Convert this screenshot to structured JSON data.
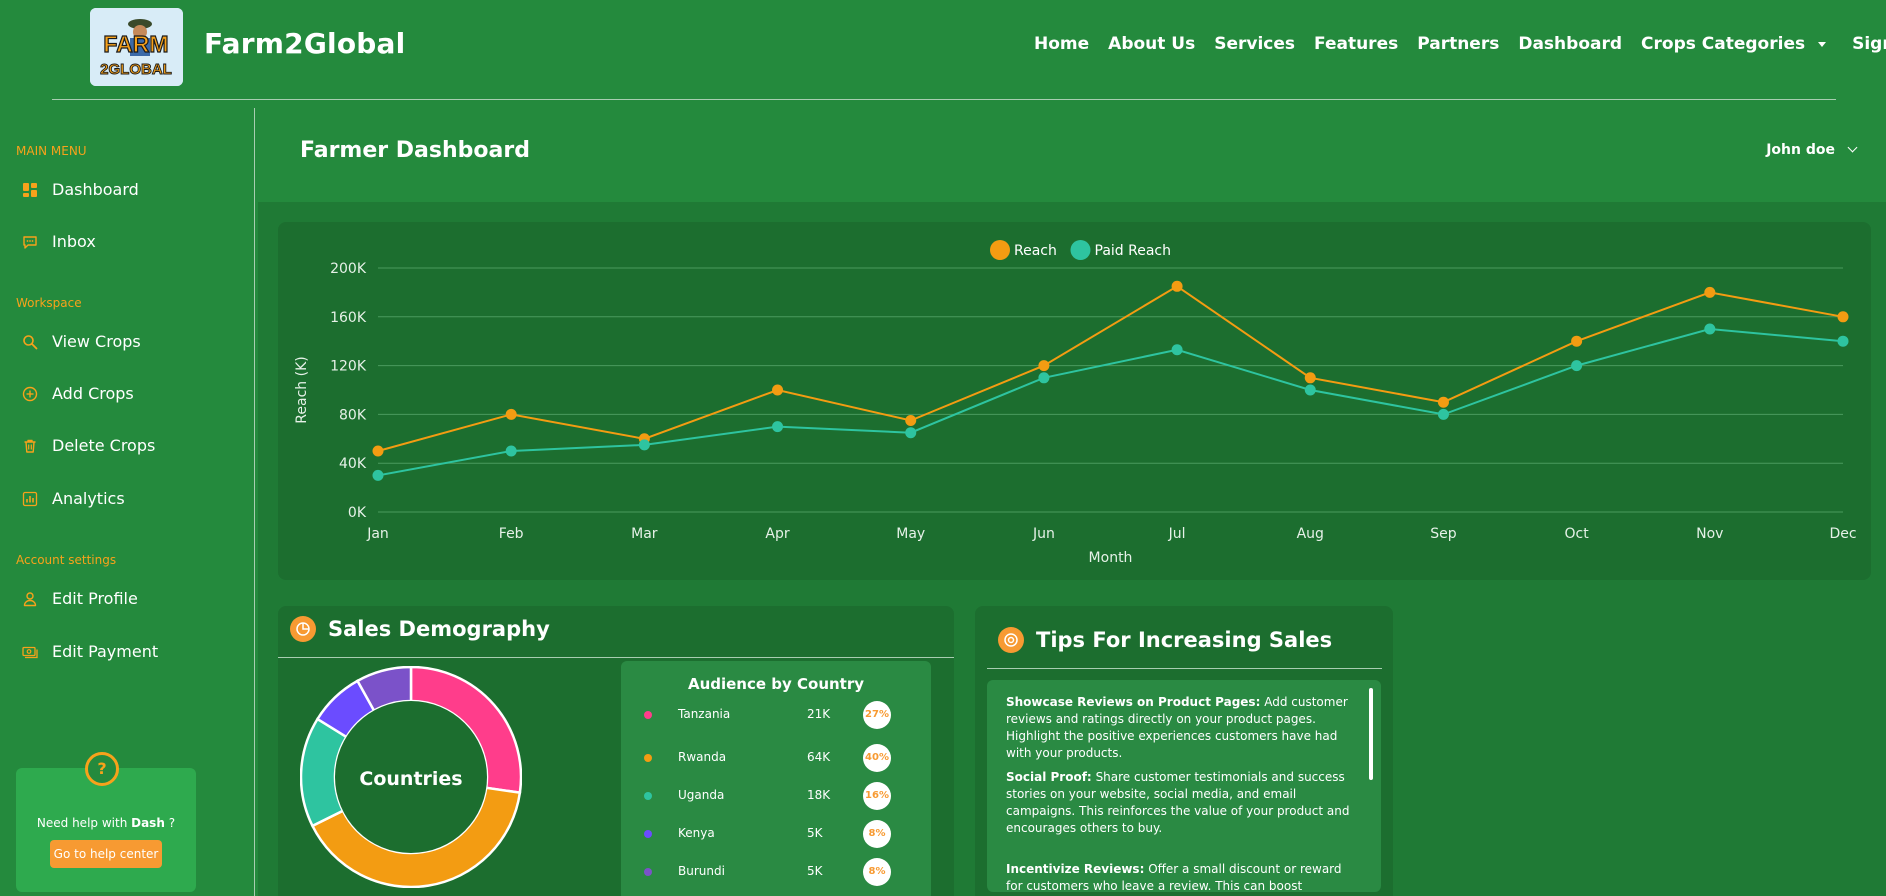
{
  "brand": {
    "name": "Farm2Global",
    "logo_text_top": "FARM",
    "logo_text_bottom": "2GLOBAL"
  },
  "nav": {
    "items": [
      "Home",
      "About Us",
      "Services",
      "Features",
      "Partners",
      "Dashboard"
    ],
    "dropdown_label": "Crops Categories",
    "signup": "Sign up"
  },
  "sidebar": {
    "main_menu_heading": "MAIN MENU",
    "main_items": [
      {
        "label": "Dashboard",
        "icon": "grid-icon"
      },
      {
        "label": "Inbox",
        "icon": "chat-icon"
      }
    ],
    "workspace_heading": "Workspace",
    "workspace_items": [
      {
        "label": "View Crops",
        "icon": "search-icon"
      },
      {
        "label": "Add Crops",
        "icon": "plus-circle-icon"
      },
      {
        "label": "Delete Crops",
        "icon": "trash-icon"
      },
      {
        "label": "Analytics",
        "icon": "chart-icon"
      }
    ],
    "account_heading": "Account settings",
    "account_items": [
      {
        "label": "Edit Profile",
        "icon": "user-icon"
      },
      {
        "label": "Edit Payment",
        "icon": "payment-icon"
      }
    ],
    "help": {
      "text_prefix": "Need help with",
      "text_bold": "Dash",
      "text_suffix": "?",
      "button": "Go to help center",
      "icon": "question-icon"
    }
  },
  "header": {
    "title": "Farmer Dashboard",
    "user": "John doe"
  },
  "colors": {
    "accent": "#f79a32",
    "reach": "#f39c12",
    "paid_reach": "#2ec4a0",
    "pink": "#ff3d8b",
    "blue": "#6b4cff",
    "purple": "#7b52c9"
  },
  "chart_data": {
    "type": "line",
    "categories": [
      "Jan",
      "Feb",
      "Mar",
      "Apr",
      "May",
      "Jun",
      "Jul",
      "Aug",
      "Sep",
      "Oct",
      "Nov",
      "Dec"
    ],
    "series": [
      {
        "name": "Reach",
        "color": "#f39c12",
        "values": [
          50,
          80,
          60,
          100,
          75,
          120,
          185,
          110,
          90,
          140,
          180,
          160
        ]
      },
      {
        "name": "Paid Reach",
        "color": "#2ec4a0",
        "values": [
          30,
          50,
          55,
          70,
          65,
          110,
          133,
          100,
          80,
          120,
          150,
          140
        ]
      }
    ],
    "yticks": [
      "0K",
      "40K",
      "80K",
      "120K",
      "160K",
      "200K"
    ],
    "ylim": [
      0,
      200
    ],
    "xlabel": "Month",
    "ylabel": "Reach (K)",
    "legend": "top-center",
    "grid": true
  },
  "sales": {
    "title": "Sales Demography",
    "donut_center": "Countries",
    "audience_title": "Audience by Country",
    "countries": [
      {
        "name": "Tanzania",
        "value": "21K",
        "percent": "27%",
        "share": 27,
        "color": "#ff3d8b"
      },
      {
        "name": "Rwanda",
        "value": "64K",
        "percent": "40%",
        "share": 40,
        "color": "#f39c12"
      },
      {
        "name": "Uganda",
        "value": "18K",
        "percent": "16%",
        "share": 16,
        "color": "#2ec4a0"
      },
      {
        "name": "Kenya",
        "value": "5K",
        "percent": "8%",
        "share": 8,
        "color": "#6b4cff"
      },
      {
        "name": "Burundi",
        "value": "5K",
        "percent": "8%",
        "share": 8,
        "color": "#7b52c9"
      }
    ]
  },
  "tips": {
    "title": "Tips For Increasing Sales",
    "items": [
      {
        "heading": "Showcase Reviews on Product Pages:",
        "body": "Add customer reviews and ratings directly on your product pages. Highlight the positive experiences customers have had with your products."
      },
      {
        "heading": "Social Proof:",
        "body": "Share customer testimonials and success stories on your website, social media, and email campaigns. This reinforces the value of your product and encourages others to buy."
      },
      {
        "heading": "Incentivize Reviews:",
        "body": "Offer a small discount or reward for customers who leave a review. This can boost engagement"
      }
    ]
  }
}
